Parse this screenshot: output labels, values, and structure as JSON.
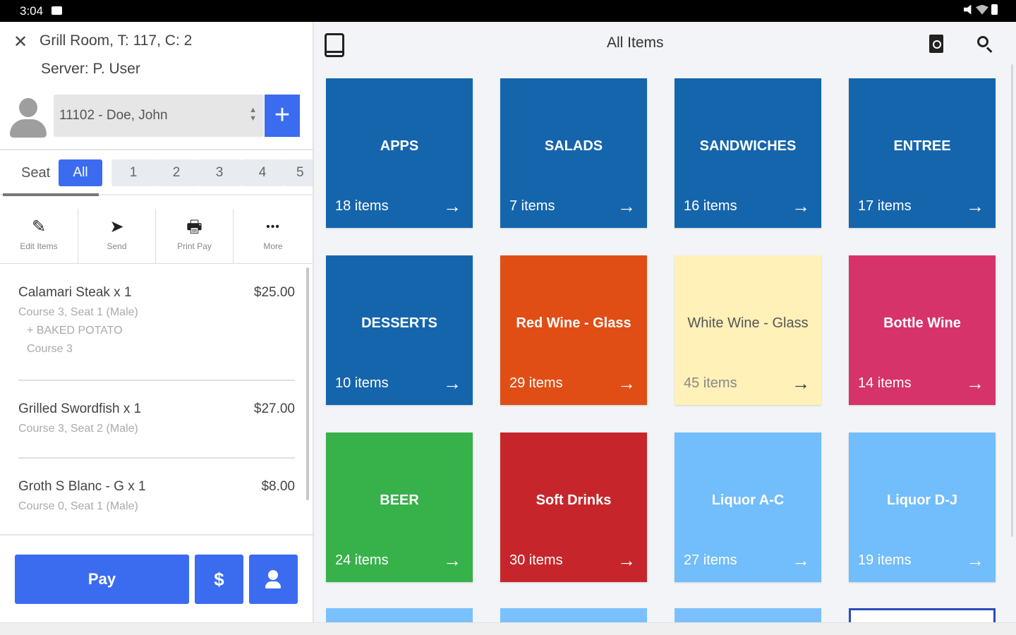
{
  "status_bar": {
    "time": "3:04"
  },
  "order": {
    "table_info": "Grill Room, T: 117, C: 2",
    "server": "Server: P. User",
    "customer": "11102 - Doe, John",
    "add_label": "+",
    "seat_label": "Seat",
    "seats": [
      "All",
      "1",
      "2",
      "3",
      "4",
      "5"
    ],
    "actions": [
      {
        "label": "Edit Items",
        "icon": "pencil-icon",
        "glyph": "✎"
      },
      {
        "label": "Send",
        "icon": "send-icon",
        "glyph": "➤"
      },
      {
        "label": "Print Pay",
        "icon": "printer-icon",
        "glyph": "🖶"
      },
      {
        "label": "More",
        "icon": "more-icon",
        "glyph": "•••"
      }
    ],
    "items": [
      {
        "name": "Calamari Steak x 1",
        "price": "$25.00",
        "details": [
          "Course 3, Seat 1 (Male)",
          "+ BAKED POTATO",
          "Course 3"
        ]
      },
      {
        "name": "Grilled Swordfish x 1",
        "price": "$27.00",
        "details": [
          "Course 3, Seat 2 (Male)"
        ]
      },
      {
        "name": "Groth S Blanc - G x 1",
        "price": "$8.00",
        "details": [
          "Course 0, Seat 1 (Male)"
        ]
      }
    ],
    "pay_label": "Pay",
    "dollar_label": "$"
  },
  "menu": {
    "title": "All Items",
    "categories": [
      {
        "name": "APPS",
        "count": "18 items",
        "color": "#1565ad"
      },
      {
        "name": "SALADS",
        "count": "7 items",
        "color": "#1565ad"
      },
      {
        "name": "SANDWICHES",
        "count": "16 items",
        "color": "#1565ad"
      },
      {
        "name": "ENTREE",
        "count": "17 items",
        "color": "#1565ad"
      },
      {
        "name": "DESSERTS",
        "count": "10 items",
        "color": "#1565ad"
      },
      {
        "name": "Red Wine - Glass",
        "count": "29 items",
        "color": "#e04e16"
      },
      {
        "name": "White Wine - Glass",
        "count": "45 items",
        "color": "#fff1b8"
      },
      {
        "name": "Bottle Wine",
        "count": "14 items",
        "color": "#d6336a"
      },
      {
        "name": "BEER",
        "count": "24 items",
        "color": "#37b14a"
      },
      {
        "name": "Soft Drinks",
        "count": "30 items",
        "color": "#c6262b"
      },
      {
        "name": "Liquor A-C",
        "count": "27 items",
        "color": "#72bdfb"
      },
      {
        "name": "Liquor D-J",
        "count": "19 items",
        "color": "#72bdfb"
      }
    ],
    "arrow": "→"
  }
}
